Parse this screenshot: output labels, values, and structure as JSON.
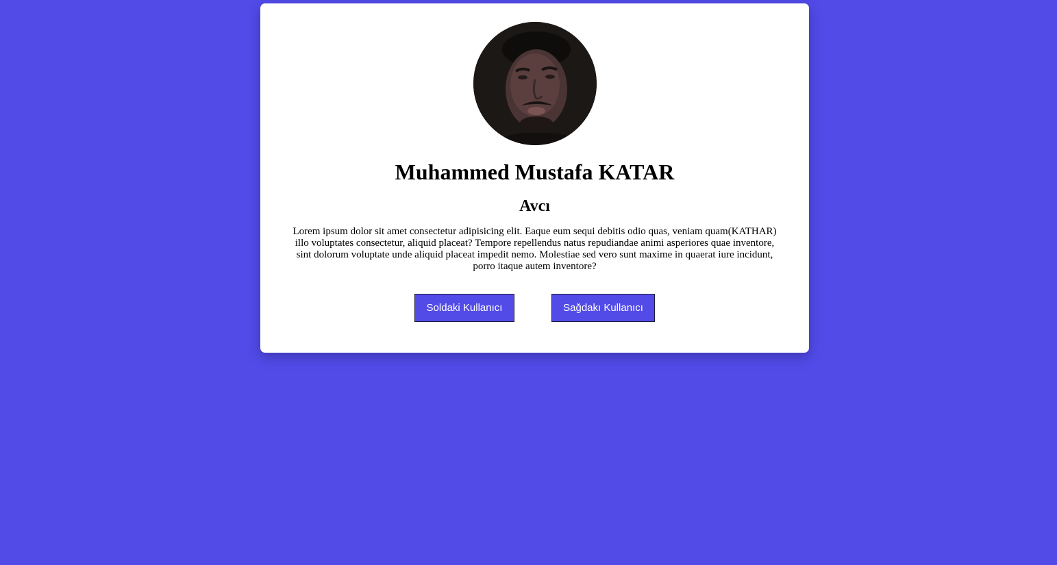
{
  "colors": {
    "background": "#524be8",
    "card": "#ffffff",
    "button": "#524be8",
    "button_text": "#ffffff"
  },
  "profile": {
    "avatar_icon": "profile-photo",
    "name": "Muhammed Mustafa KATAR",
    "role": "Avcı",
    "description": "Lorem ipsum dolor sit amet consectetur adipisicing elit. Eaque eum sequi debitis odio quas, veniam quam(KATHAR) illo voluptates consectetur, aliquid placeat? Tempore repellendus natus repudiandae animi asperiores quae inventore, sint dolorum voluptate unde aliquid placeat impedit nemo. Molestiae sed vero sunt maxime in quaerat iure incidunt, porro itaque autem inventore?"
  },
  "buttons": {
    "left_label": "Soldaki Kullanıcı",
    "right_label": "Sağdakı Kullanıcı"
  }
}
